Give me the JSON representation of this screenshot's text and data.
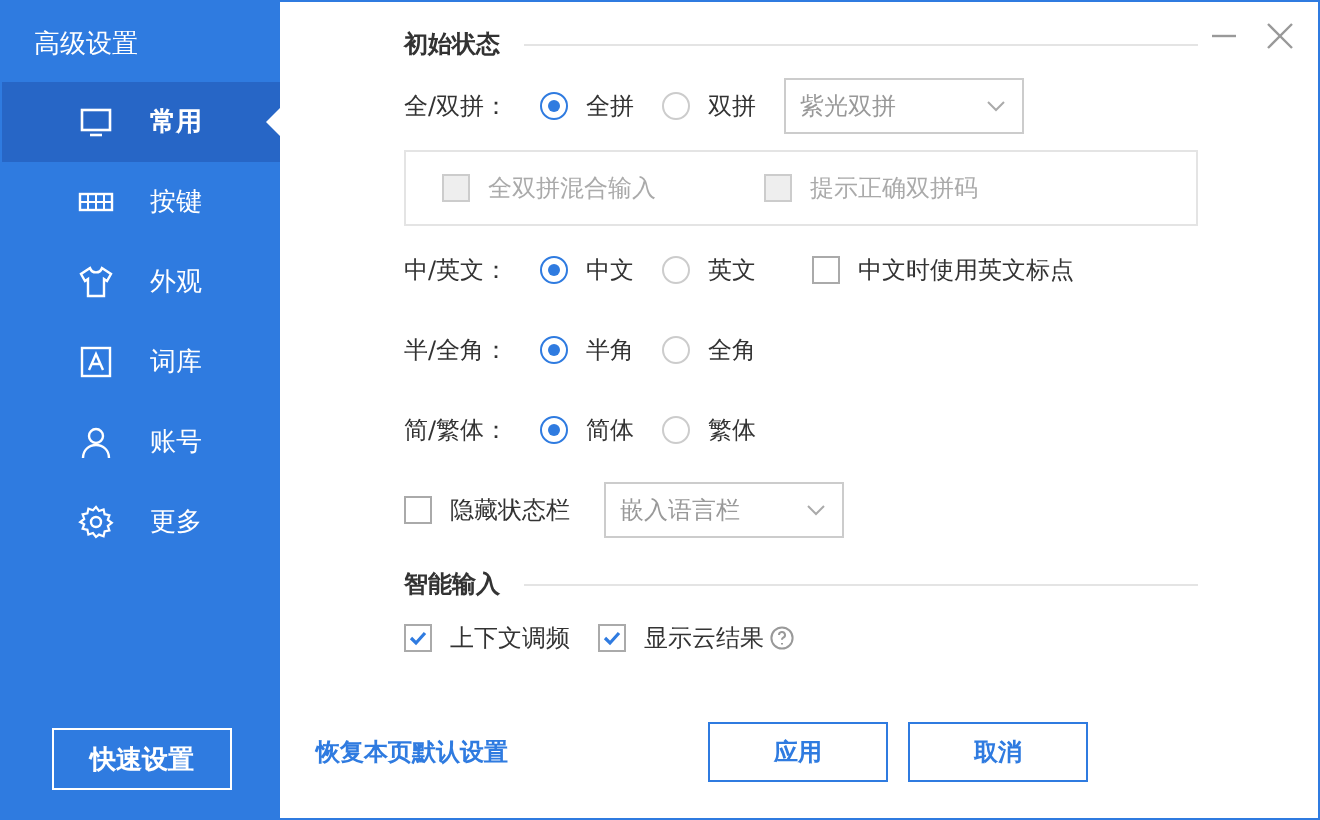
{
  "window": {
    "title": "高级设置"
  },
  "sidebar": {
    "items": [
      {
        "label": "常用",
        "selected": true
      },
      {
        "label": "按键",
        "selected": false
      },
      {
        "label": "外观",
        "selected": false
      },
      {
        "label": "词库",
        "selected": false
      },
      {
        "label": "账号",
        "selected": false
      },
      {
        "label": "更多",
        "selected": false
      }
    ],
    "quick_button": "快速设置"
  },
  "sections": [
    {
      "title": "初始状态",
      "rows": [
        {
          "kind": "radio",
          "label": "全/双拼：",
          "options": [
            {
              "label": "全拼",
              "selected": true
            },
            {
              "label": "双拼",
              "selected": false
            }
          ],
          "select": {
            "value": "紫光双拼"
          }
        },
        {
          "kind": "group",
          "checkboxes": [
            {
              "label": "全双拼混合输入",
              "checked": false,
              "disabled": true
            },
            {
              "label": "提示正确双拼码",
              "checked": false,
              "disabled": true
            }
          ]
        },
        {
          "kind": "radio",
          "label": "中/英文：",
          "options": [
            {
              "label": "中文",
              "selected": true
            },
            {
              "label": "英文",
              "selected": false
            }
          ],
          "checkbox": {
            "label": "中文时使用英文标点",
            "checked": false,
            "disabled": false
          }
        },
        {
          "kind": "radio",
          "label": "半/全角：",
          "options": [
            {
              "label": "半角",
              "selected": true
            },
            {
              "label": "全角",
              "selected": false
            }
          ]
        },
        {
          "kind": "radio",
          "label": "简/繁体：",
          "options": [
            {
              "label": "简体",
              "selected": true
            },
            {
              "label": "繁体",
              "selected": false
            }
          ]
        },
        {
          "kind": "checkselect",
          "checkbox": {
            "label": "隐藏状态栏",
            "checked": false,
            "disabled": false
          },
          "select": {
            "value": "嵌入语言栏"
          }
        }
      ]
    },
    {
      "title": "智能输入",
      "rows": [
        {
          "kind": "checks",
          "checkboxes": [
            {
              "label": "上下文调频",
              "checked": true,
              "disabled": false
            },
            {
              "label": "显示云结果",
              "checked": true,
              "disabled": false,
              "help": true
            }
          ]
        }
      ]
    }
  ],
  "footer": {
    "reset_link": "恢复本页默认设置",
    "buttons": [
      "应用",
      "取消"
    ]
  }
}
